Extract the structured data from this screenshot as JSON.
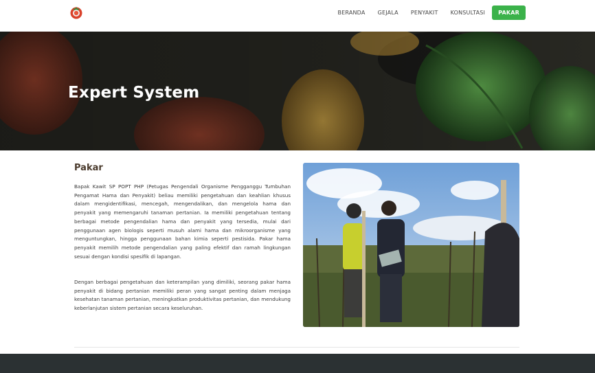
{
  "nav": {
    "items": [
      "BERANDA",
      "GEJALA",
      "PENYAKIT",
      "KONSULTASI"
    ],
    "active": "PAKAR",
    "accent": "#3bb24a"
  },
  "hero": {
    "title": "Expert System"
  },
  "section": {
    "title": "Pakar",
    "paragraph1": "Bapak Kawit SP POPT PHP (Petugas Pengendali Organisme Pengganggu Tumbuhan Pengamat Hama dan Penyakit) beliau memiliki pengetahuan dan keahlian khusus dalam mengidentifikasi, mencegah, mengendalikan, dan mengelola hama dan penyakit yang memengaruhi tanaman pertanian. Ia memiliki pengetahuan tentang berbagai metode pengendalian hama dan penyakit yang tersedia, mulai dari penggunaan agen biologis seperti musuh alami hama dan mikroorganisme yang menguntungkan, hingga penggunaan bahan kimia seperti pestisida. Pakar hama penyakit memilih metode pengendalian yang paling efektif dan ramah lingkungan sesuai dengan kondisi spesifik di lapangan.",
    "paragraph2": "Dengan berbagai pengetahuan dan keterampilan yang dimiliki, seorang pakar hama penyakit di bidang pertanian memiliki peran yang sangat penting dalam menjaga kesehatan tanaman pertanian, meningkatkan produktivitas pertanian, dan mendukung keberlanjutan sistem pertanian secara keseluruhan."
  },
  "colors": {
    "footer": "#2b3133",
    "title": "#4a3a2c"
  }
}
